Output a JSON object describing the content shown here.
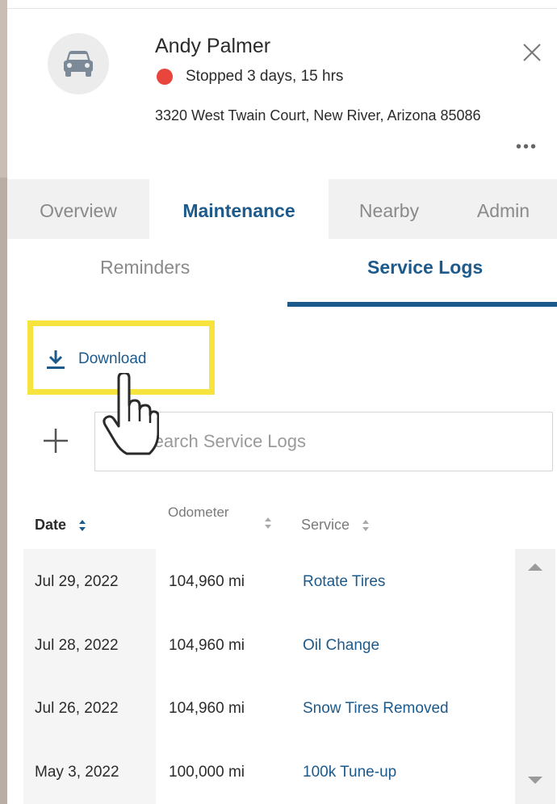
{
  "vehicle": {
    "driver_name": "Andy Palmer",
    "status_text": "Stopped 3 days, 15 hrs",
    "status_color": "#e8453c",
    "address": "3320 West Twain Court, New River, Arizona 85086",
    "avatar_icon": "car-icon",
    "more_label": "•••"
  },
  "tabs": [
    {
      "label": "Overview",
      "active": false
    },
    {
      "label": "Maintenance",
      "active": true
    },
    {
      "label": "Nearby",
      "active": false
    },
    {
      "label": "Admin",
      "active": false
    }
  ],
  "subtabs": [
    {
      "label": "Reminders",
      "active": false
    },
    {
      "label": "Service Logs",
      "active": true
    }
  ],
  "download": {
    "label": "Download",
    "icon": "download-icon"
  },
  "search": {
    "placeholder": "Search Service Logs",
    "value": ""
  },
  "table": {
    "headers": {
      "date": "Date",
      "odometer": "Odometer",
      "service": "Service"
    },
    "rows": [
      {
        "date": "Jul 29, 2022",
        "odometer": "104,960 mi",
        "service": "Rotate Tires"
      },
      {
        "date": "Jul 28, 2022",
        "odometer": "104,960 mi",
        "service": "Oil Change"
      },
      {
        "date": "Jul 26, 2022",
        "odometer": "104,960 mi",
        "service": "Snow Tires Removed"
      },
      {
        "date": "May 3, 2022",
        "odometer": "100,000 mi",
        "service": "100k Tune-up"
      }
    ]
  },
  "colors": {
    "accent": "#1d5a8c",
    "highlight": "#f7e33d"
  }
}
